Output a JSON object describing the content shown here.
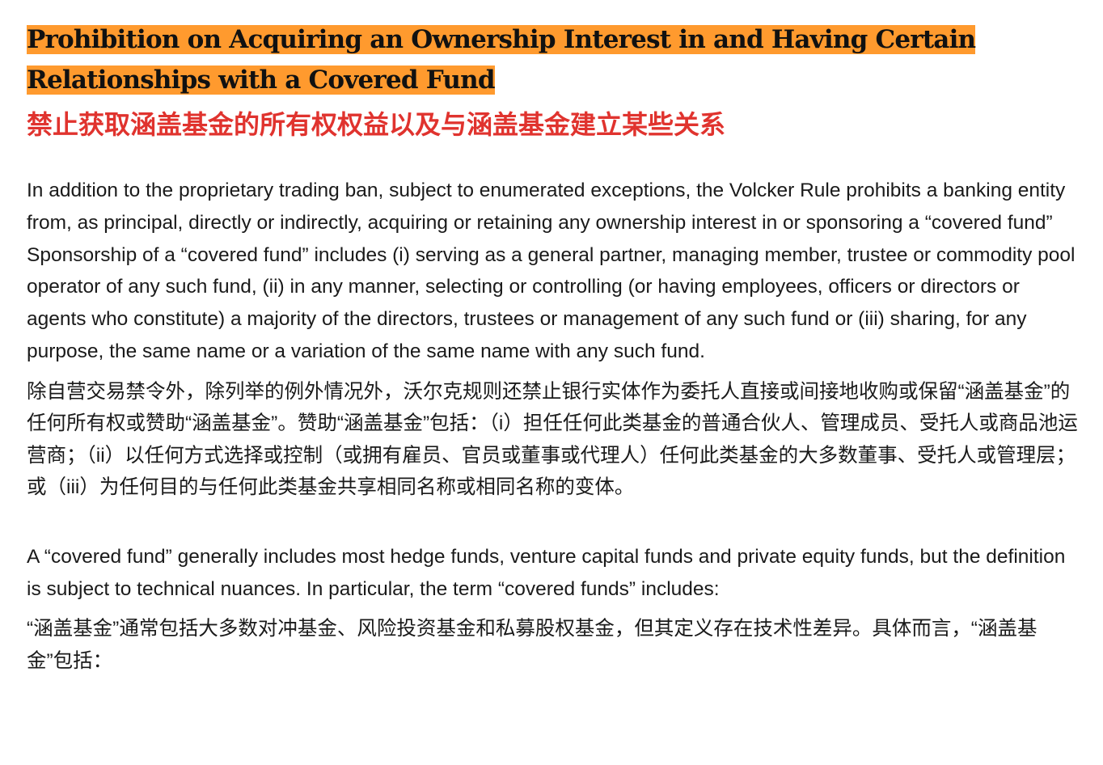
{
  "heading": {
    "title_en": "Prohibition on Acquiring an Ownership Interest in and Having Certain Relationships with a Covered Fund",
    "title_zh": "禁止获取涵盖基金的所有权权益以及与涵盖基金建立某些关系",
    "highlight_color": "#ff9a2e",
    "title_zh_color": "#e0332e"
  },
  "body": {
    "paragraph_1_en": "In addition to the proprietary trading ban, subject to enumerated exceptions, the Volcker Rule prohibits a banking entity from, as principal, directly or indirectly, acquiring or retaining any ownership interest in or sponsoring a “covered fund” Sponsorship of a “covered fund” includes (i) serving as a general partner, managing member, trustee or commodity pool operator of any such fund, (ii) in any manner, selecting or controlling (or having employees, officers or directors or agents who constitute) a majority of the directors, trustees or management of any such fund or (iii) sharing, for any purpose, the same name or a variation of the same name with any such fund.",
    "paragraph_1_zh": "除自营交易禁令外，除列举的例外情况外，沃尔克规则还禁止银行实体作为委托人直接或间接地收购或保留“涵盖基金”的任何所有权或赞助“涵盖基金”。赞助“涵盖基金”包括：（i）担任任何此类基金的普通合伙人、管理成员、受托人或商品池运营商；（ii）以任何方式选择或控制（或拥有雇员、官员或董事或代理人）任何此类基金的大多数董事、受托人或管理层；或（iii）为任何目的与任何此类基金共享相同名称或相同名称的变体。",
    "paragraph_2_en": "A “covered fund” generally includes most hedge funds, venture capital funds and private equity funds, but the definition is subject to technical nuances. In particular, the term “covered funds” includes:",
    "paragraph_2_zh": "“涵盖基金”通常包括大多数对冲基金、风险投资基金和私募股权基金，但其定义存在技术性差异。具体而言，“涵盖基金”包括："
  }
}
